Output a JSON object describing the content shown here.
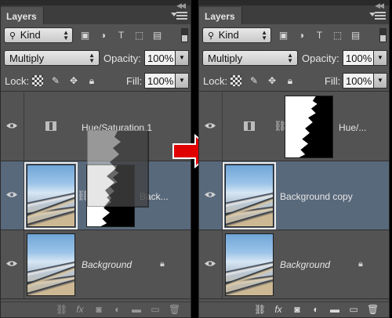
{
  "left_panel": {
    "tab_label": "Layers",
    "filter_kind": "Kind",
    "blend_mode": "Multiply",
    "opacity_label": "Opacity:",
    "opacity_value": "100%",
    "lock_label": "Lock:",
    "fill_label": "Fill:",
    "fill_value": "100%",
    "layers": [
      {
        "name": "Hue/Saturation 1",
        "type": "adjustment"
      },
      {
        "name": "Back...",
        "type": "masked",
        "selected": true
      },
      {
        "name": "Background",
        "type": "locked"
      }
    ]
  },
  "right_panel": {
    "tab_label": "Layers",
    "filter_kind": "Kind",
    "blend_mode": "Multiply",
    "opacity_label": "Opacity:",
    "opacity_value": "100%",
    "lock_label": "Lock:",
    "fill_label": "Fill:",
    "fill_value": "100%",
    "layers": [
      {
        "name": "Hue/...",
        "type": "adjustment-masked"
      },
      {
        "name": "Background copy",
        "type": "pixel",
        "selected": true
      },
      {
        "name": "Background",
        "type": "locked"
      }
    ]
  },
  "colors": {
    "panel_bg": "#535353",
    "selected_row": "#59697c",
    "arrow": "#e00000"
  },
  "icons": [
    "eye-icon",
    "link-icon",
    "fx-icon",
    "mask-icon",
    "adjustment-icon",
    "folder-icon",
    "new-layer-icon",
    "trash-icon",
    "lock-icon"
  ]
}
